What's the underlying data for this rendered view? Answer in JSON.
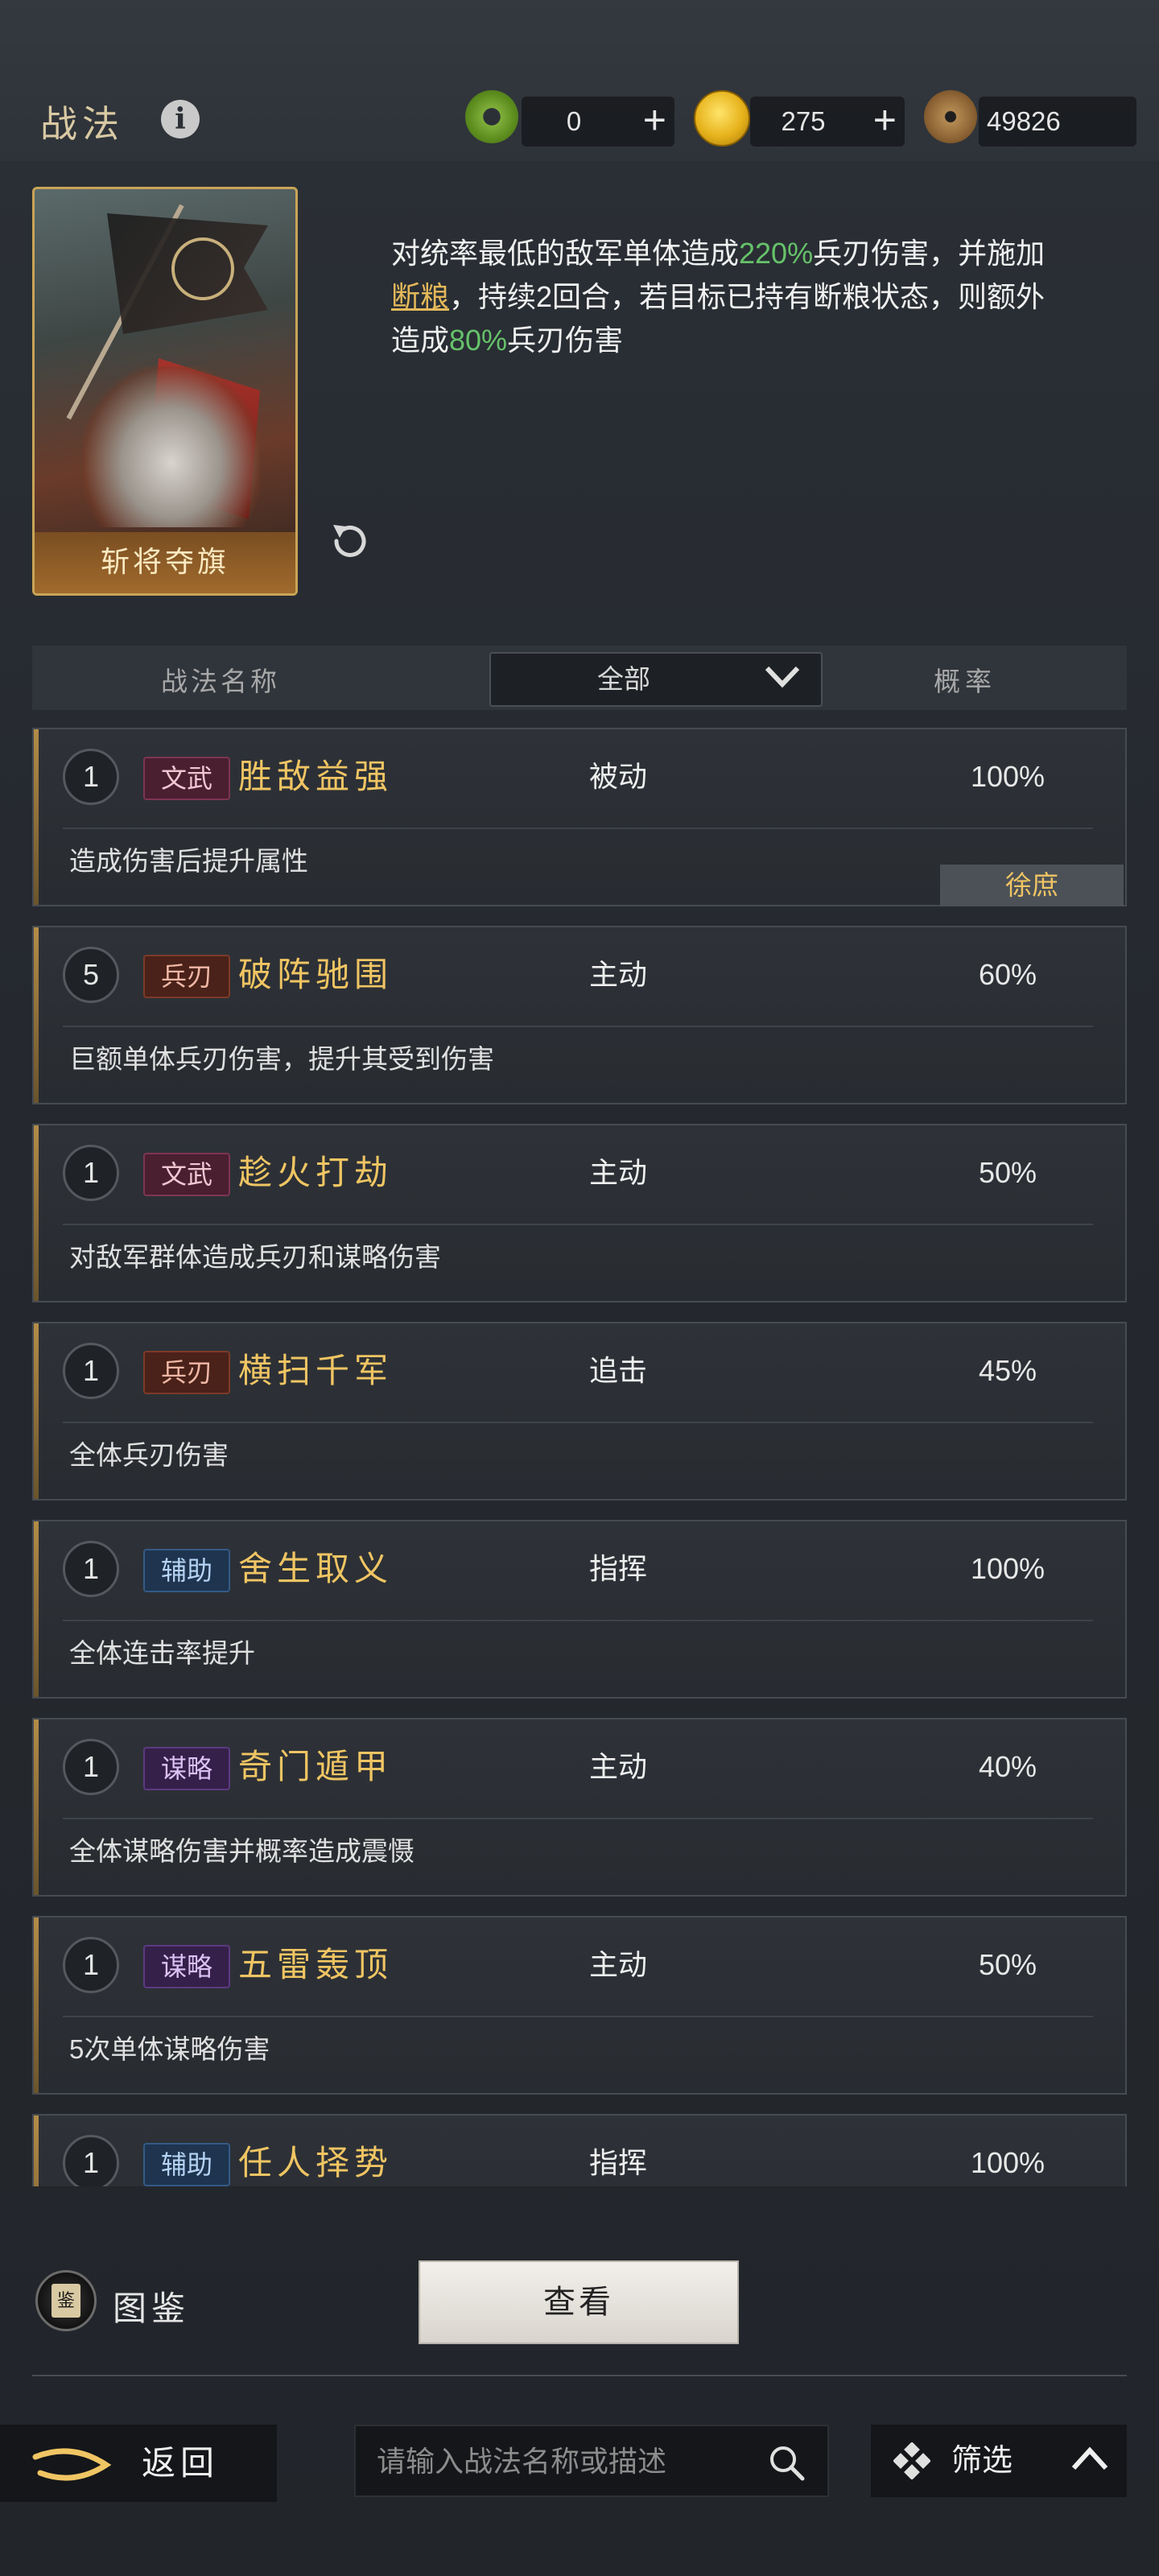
{
  "header": {
    "title": "战法",
    "currencies": [
      {
        "name": "jade-icon",
        "value": "0"
      },
      {
        "name": "gold-icon",
        "value": "275"
      },
      {
        "name": "copper-icon",
        "value": "49826"
      }
    ],
    "plus": "+"
  },
  "detail": {
    "card_name": "斩将夺旗",
    "desc_parts": [
      "对统率最低的敌军单体造成",
      "220%",
      "兵刃伤害，并施加",
      "断粮",
      "，持续2回合，若目标已持有断粮状态，则额外造成",
      "80%",
      "兵刃伤害"
    ]
  },
  "table_header": {
    "name": "战法名称",
    "filter": "全部",
    "rate": "概率"
  },
  "skills": [
    {
      "level": "1",
      "tag": "文武",
      "tag_class": "wenwu",
      "name": "胜敌益强",
      "type": "被动",
      "rate": "100%",
      "desc": "造成伤害后提升属性",
      "owner": "徐庶"
    },
    {
      "level": "5",
      "tag": "兵刃",
      "tag_class": "bingren",
      "name": "破阵驰围",
      "type": "主动",
      "rate": "60%",
      "desc": "巨额单体兵刃伤害，提升其受到伤害"
    },
    {
      "level": "1",
      "tag": "文武",
      "tag_class": "wenwu",
      "name": "趁火打劫",
      "type": "主动",
      "rate": "50%",
      "desc": "对敌军群体造成兵刃和谋略伤害"
    },
    {
      "level": "1",
      "tag": "兵刃",
      "tag_class": "bingren",
      "name": "横扫千军",
      "type": "追击",
      "rate": "45%",
      "desc": "全体兵刃伤害"
    },
    {
      "level": "1",
      "tag": "辅助",
      "tag_class": "fuzhu",
      "name": "舍生取义",
      "type": "指挥",
      "rate": "100%",
      "desc": "全体连击率提升"
    },
    {
      "level": "1",
      "tag": "谋略",
      "tag_class": "moulue",
      "name": "奇门遁甲",
      "type": "主动",
      "rate": "40%",
      "desc": "全体谋略伤害并概率造成震慑"
    },
    {
      "level": "1",
      "tag": "谋略",
      "tag_class": "moulue",
      "name": "五雷轰顶",
      "type": "主动",
      "rate": "50%",
      "desc": "5次单体谋略伤害"
    },
    {
      "level": "1",
      "tag": "辅助",
      "tag_class": "fuzhu",
      "name": "任人择势",
      "type": "指挥",
      "rate": "100%",
      "desc": ""
    }
  ],
  "bottom": {
    "codex_label": "图鉴",
    "codex_glyph": "鉴",
    "view_label": "查看",
    "back_label": "返回",
    "search_placeholder": "请输入战法名称或描述",
    "filter_label": "筛选"
  }
}
